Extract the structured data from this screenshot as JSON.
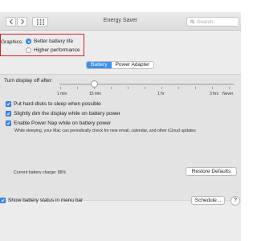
{
  "window": {
    "title": "Energy Saver"
  },
  "toolbar": {
    "search_placeholder": "Search",
    "icons": [
      "chevron-left-icon",
      "chevron-right-icon",
      "grid-icon",
      "search-icon"
    ]
  },
  "graphics": {
    "label": "Graphics:",
    "options": [
      "Better battery life",
      "Higher performance"
    ],
    "selected": "Better battery life"
  },
  "tabs": {
    "items": [
      "Battery",
      "Power Adapter"
    ],
    "active": "Battery"
  },
  "display_sleep": {
    "label": "Turn display off after:",
    "ticks": [
      "1 min",
      "15 min",
      "1 hr",
      "3 hrs",
      "Never"
    ]
  },
  "options": [
    {
      "label": "Put hard disks to sleep when possible",
      "checked": true
    },
    {
      "label": "Slightly dim the display while on battery power",
      "checked": true
    },
    {
      "label": "Enable Power Nap while on battery power",
      "checked": true
    }
  ],
  "power_nap_note": "While sleeping, your Mac can periodically check for new email, calendar, and other iCloud updates",
  "battery_charge": "Current battery charge: 88%",
  "buttons": {
    "restore": "Restore Defaults",
    "schedule": "Schedule...",
    "help": "?"
  },
  "menu_bar_option": {
    "label": "Show battery status in menu bar",
    "checked": true
  },
  "colors": {
    "accent": "#3d8ef1",
    "highlight_box": "#d22323"
  }
}
